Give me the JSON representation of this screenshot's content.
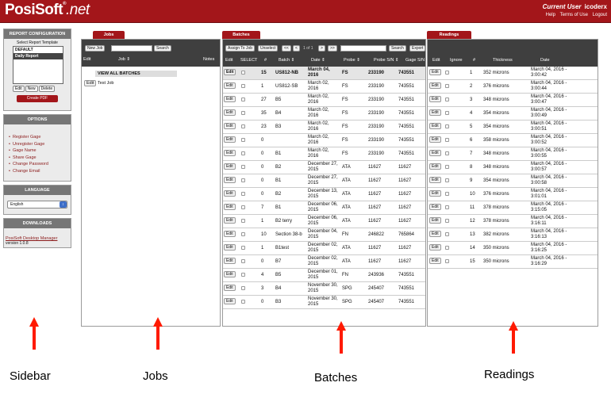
{
  "header": {
    "logo_main": "PosiSoft",
    "logo_tm": "®",
    "logo_suffix": ".net",
    "user_label": "Current User",
    "user_name": "icoderx",
    "links": [
      "Help",
      "Terms of Use",
      "Logout"
    ]
  },
  "sidebar": {
    "report_config": {
      "title": "REPORT CONFIGURATION",
      "subtitle": "Select Report Template",
      "templates": [
        "DEFAULT",
        "Daily Report"
      ],
      "selected": "Daily Report",
      "buttons": [
        "Edit",
        "New",
        "Delete"
      ],
      "create_pdf": "Create PDF"
    },
    "options": {
      "title": "OPTIONS",
      "items": [
        "Register Gage",
        "Unregister Gage",
        "Gage Name",
        "Share Gage",
        "Change Password",
        "Change Email"
      ]
    },
    "language": {
      "title": "LANGUAGE",
      "selected": "English"
    },
    "downloads": {
      "title": "DOWNLOADS",
      "link": "PosiSoft Desktop Manager",
      "version": "version 1.0.8"
    }
  },
  "jobs": {
    "tab": "Jobs",
    "new_job": "New Job",
    "search_button": "Search",
    "columns": {
      "edit": "Edit",
      "job": "Job ⇕",
      "notes": "Notes"
    },
    "view_all": "VIEW ALL BATCHES",
    "rows": [
      {
        "edit": "Edit",
        "name": "Test Job"
      }
    ]
  },
  "batches": {
    "tab": "Batches",
    "assign_to_job": "Assign To Job",
    "unselect": "Unselect",
    "nav": [
      "<<",
      "<",
      "1 of 1",
      ">",
      ">>"
    ],
    "search_button": "Search",
    "export_button": "Export",
    "columns": {
      "edit": "Edit",
      "select": "SELECT",
      "num": "#",
      "batch": "Batch ⇕",
      "date": "Date ⇕",
      "probe": "Probe ⇕",
      "probe_sn": "Probe S/N ⇕",
      "gage_sn": "Gage S/N"
    },
    "rows": [
      {
        "num": "15",
        "batch": "US812-NB",
        "date": "March 04, 2016",
        "probe": "FS",
        "probe_sn": "233190",
        "gage_sn": "743551"
      },
      {
        "num": "1",
        "batch": "US812-SB",
        "date": "March 02, 2016",
        "probe": "FS",
        "probe_sn": "233190",
        "gage_sn": "743551"
      },
      {
        "num": "27",
        "batch": "B5",
        "date": "March 02, 2016",
        "probe": "FS",
        "probe_sn": "233190",
        "gage_sn": "743551"
      },
      {
        "num": "35",
        "batch": "B4",
        "date": "March 02, 2016",
        "probe": "FS",
        "probe_sn": "233190",
        "gage_sn": "743551"
      },
      {
        "num": "23",
        "batch": "B3",
        "date": "March 02, 2016",
        "probe": "FS",
        "probe_sn": "233190",
        "gage_sn": "743551"
      },
      {
        "num": "0",
        "batch": "",
        "date": "March 02, 2016",
        "probe": "FS",
        "probe_sn": "233190",
        "gage_sn": "743551"
      },
      {
        "num": "0",
        "batch": "B1",
        "date": "March 02, 2016",
        "probe": "FS",
        "probe_sn": "233190",
        "gage_sn": "743551"
      },
      {
        "num": "0",
        "batch": "B2",
        "date": "December 27, 2015",
        "probe": "ATA",
        "probe_sn": "11627",
        "gage_sn": "11627"
      },
      {
        "num": "0",
        "batch": "B1",
        "date": "December 27, 2015",
        "probe": "ATA",
        "probe_sn": "11627",
        "gage_sn": "11627"
      },
      {
        "num": "0",
        "batch": "B2",
        "date": "December 13, 2015",
        "probe": "ATA",
        "probe_sn": "11627",
        "gage_sn": "11627"
      },
      {
        "num": "7",
        "batch": "B1",
        "date": "December 06, 2015",
        "probe": "ATA",
        "probe_sn": "11627",
        "gage_sn": "11627"
      },
      {
        "num": "1",
        "batch": "B2 terry",
        "date": "December 06, 2015",
        "probe": "ATA",
        "probe_sn": "11627",
        "gage_sn": "11627"
      },
      {
        "num": "10",
        "batch": "Section 38-b",
        "date": "December 04, 2015",
        "probe": "FN",
        "probe_sn": "246822",
        "gage_sn": "765864"
      },
      {
        "num": "1",
        "batch": "B1test",
        "date": "December 02, 2015",
        "probe": "ATA",
        "probe_sn": "11627",
        "gage_sn": "11627"
      },
      {
        "num": "0",
        "batch": "B7",
        "date": "December 02, 2015",
        "probe": "ATA",
        "probe_sn": "11627",
        "gage_sn": "11627"
      },
      {
        "num": "4",
        "batch": "B5",
        "date": "December 01, 2015",
        "probe": "FN",
        "probe_sn": "243936",
        "gage_sn": "743551"
      },
      {
        "num": "3",
        "batch": "B4",
        "date": "November 30, 2015",
        "probe": "SPG",
        "probe_sn": "245407",
        "gage_sn": "743551"
      },
      {
        "num": "0",
        "batch": "B3",
        "date": "November 30, 2015",
        "probe": "SPG",
        "probe_sn": "245407",
        "gage_sn": "743551"
      }
    ]
  },
  "readings": {
    "tab": "Readings",
    "columns": {
      "edit": "Edit",
      "ignore": "Ignore",
      "num": "#",
      "thickness": "Thickness",
      "date": "Date"
    },
    "rows": [
      {
        "num": "1",
        "thickness": "352 microns",
        "date": "March 04, 2016 - 3:00:42"
      },
      {
        "num": "2",
        "thickness": "376 microns",
        "date": "March 04, 2016 - 3:00:44"
      },
      {
        "num": "3",
        "thickness": "348 microns",
        "date": "March 04, 2016 - 3:00:47"
      },
      {
        "num": "4",
        "thickness": "354 microns",
        "date": "March 04, 2016 - 3:00:49"
      },
      {
        "num": "5",
        "thickness": "354 microns",
        "date": "March 04, 2016 - 3:00:51"
      },
      {
        "num": "6",
        "thickness": "358 microns",
        "date": "March 04, 2016 - 3:00:52"
      },
      {
        "num": "7",
        "thickness": "348 microns",
        "date": "March 04, 2016 - 3:00:55"
      },
      {
        "num": "8",
        "thickness": "348 microns",
        "date": "March 04, 2016 - 3:00:57"
      },
      {
        "num": "9",
        "thickness": "354 microns",
        "date": "March 04, 2016 - 3:00:58"
      },
      {
        "num": "10",
        "thickness": "376 microns",
        "date": "March 04, 2016 - 3:01:01"
      },
      {
        "num": "11",
        "thickness": "378 microns",
        "date": "March 04, 2016 - 3:15:05"
      },
      {
        "num": "12",
        "thickness": "378 microns",
        "date": "March 04, 2016 - 3:16:11"
      },
      {
        "num": "13",
        "thickness": "382 microns",
        "date": "March 04, 2016 - 3:16:13"
      },
      {
        "num": "14",
        "thickness": "350 microns",
        "date": "March 04, 2016 - 3:16:25"
      },
      {
        "num": "15",
        "thickness": "350 microns",
        "date": "March 04, 2016 - 3:16:29"
      }
    ]
  },
  "callouts": [
    "Sidebar",
    "Jobs",
    "Batches",
    "Readings"
  ],
  "colors": {
    "brand": "#a3161a",
    "arrow": "#ff1a00",
    "panel_header": "#3f3f3f"
  }
}
